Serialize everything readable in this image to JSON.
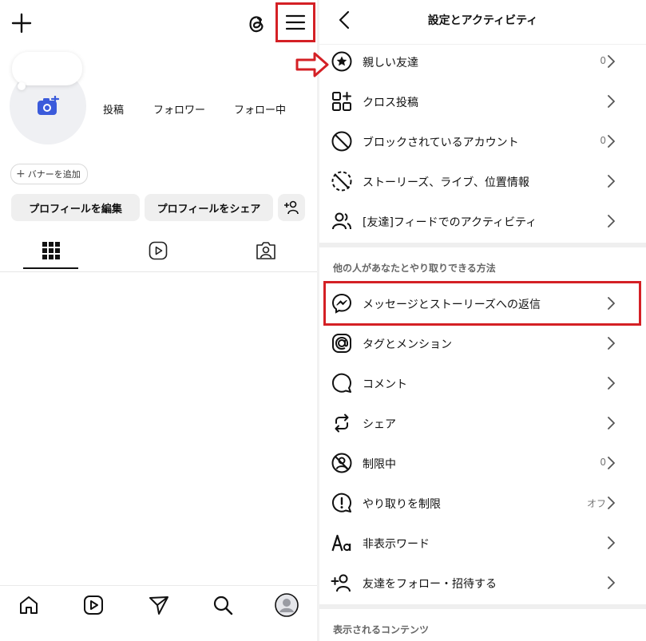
{
  "colors": {
    "highlight": "#d42025",
    "accent": "#3b5bdb",
    "text": "#111111",
    "muted": "#777777"
  },
  "left": {
    "top_icons": [
      "plus-icon",
      "threads-icon",
      "menu-icon"
    ],
    "stats": {
      "posts": "投稿",
      "followers": "フォロワー",
      "following": "フォロー中"
    },
    "banner_chip": {
      "plus": "+",
      "label": "バナーを追加"
    },
    "buttons": {
      "edit_profile": "プロフィールを編集",
      "share_profile": "プロフィールをシェア",
      "add_person_icon": "add-person-icon"
    },
    "tabs": [
      "grid-icon",
      "reels-icon",
      "tagged-icon"
    ],
    "bottom_nav": [
      "home-icon",
      "reels-icon",
      "send-icon",
      "search-icon",
      "profile-icon"
    ]
  },
  "right": {
    "title": "設定とアクティビティ",
    "group1": [
      {
        "icon": "star-circle-icon",
        "label": "親しい友達",
        "value": "0"
      },
      {
        "icon": "cross-post-icon",
        "label": "クロス投稿",
        "value": ""
      },
      {
        "icon": "block-icon",
        "label": "ブロックされているアカウント",
        "value": "0"
      },
      {
        "icon": "story-hide-icon",
        "label": "ストーリーズ、ライブ、位置情報",
        "value": ""
      },
      {
        "icon": "friends-activity-icon",
        "label": "[友達]フィードでのアクティビティ",
        "value": ""
      }
    ],
    "section2_title": "他の人があなたとやり取りできる方法",
    "group2": [
      {
        "icon": "messenger-icon",
        "label": "メッセージとストーリーズへの返信",
        "value": ""
      },
      {
        "icon": "at-mention-icon",
        "label": "タグとメンション",
        "value": ""
      },
      {
        "icon": "comment-icon",
        "label": "コメント",
        "value": ""
      },
      {
        "icon": "share-icon",
        "label": "シェア",
        "value": ""
      },
      {
        "icon": "restrict-icon",
        "label": "制限中",
        "value": "0"
      },
      {
        "icon": "limit-interactions-icon",
        "label": "やり取りを制限",
        "value": "オフ"
      },
      {
        "icon": "hidden-words-icon",
        "label": "非表示ワード",
        "value": ""
      },
      {
        "icon": "follow-invite-icon",
        "label": "友達をフォロー・招待する",
        "value": ""
      }
    ],
    "section3_title": "表示されるコンテンツ"
  }
}
